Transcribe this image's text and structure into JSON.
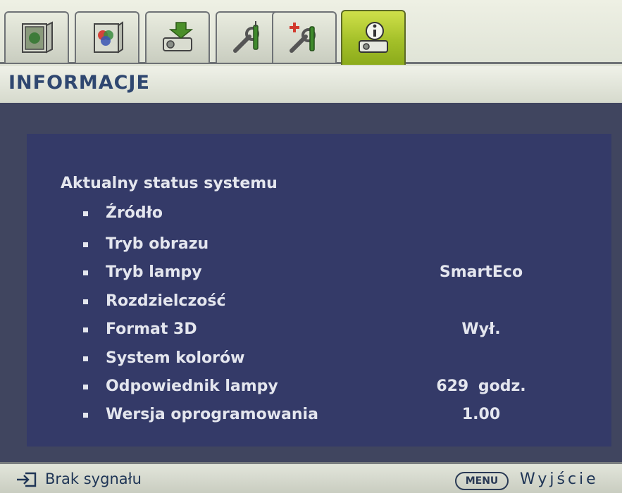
{
  "tabs": [
    {
      "name": "tab-display",
      "icon": "display-icon",
      "active": false
    },
    {
      "name": "tab-picture",
      "icon": "picture-icon",
      "active": false
    },
    {
      "name": "tab-source",
      "icon": "source-icon",
      "active": false
    },
    {
      "name": "tab-system-setup-basic",
      "icon": "setup-wrench-icon",
      "active": false
    },
    {
      "name": "tab-system-setup-advanced",
      "icon": "advanced-setup-icon",
      "active": false
    },
    {
      "name": "tab-information",
      "icon": "information-icon",
      "active": true
    }
  ],
  "header": {
    "title": "INFORMACJE"
  },
  "main": {
    "heading": "Aktualny status systemu",
    "rows": [
      {
        "label": "Źródło",
        "value": ""
      },
      {
        "label": "Tryb obrazu",
        "value": ""
      },
      {
        "label": "Tryb lampy",
        "value": "SmartEco"
      },
      {
        "label": "Rozdzielczość",
        "value": ""
      },
      {
        "label": "Format 3D",
        "value": "Wył."
      },
      {
        "label": "System kolorów",
        "value": ""
      },
      {
        "label": "Odpowiednik lampy",
        "value": "629 godz."
      },
      {
        "label": "Wersja oprogramowania",
        "value": "1.00"
      }
    ]
  },
  "footer": {
    "input_icon": "input-source-icon",
    "signal": "Brak sygnału",
    "menu_key": "MENU",
    "exit": "Wyjście"
  },
  "colors": {
    "title": "#2f4770",
    "panel": "#343a68",
    "body_bg": "#40455f",
    "active_tab": "#a4c029",
    "text": "#e4e6ee"
  }
}
